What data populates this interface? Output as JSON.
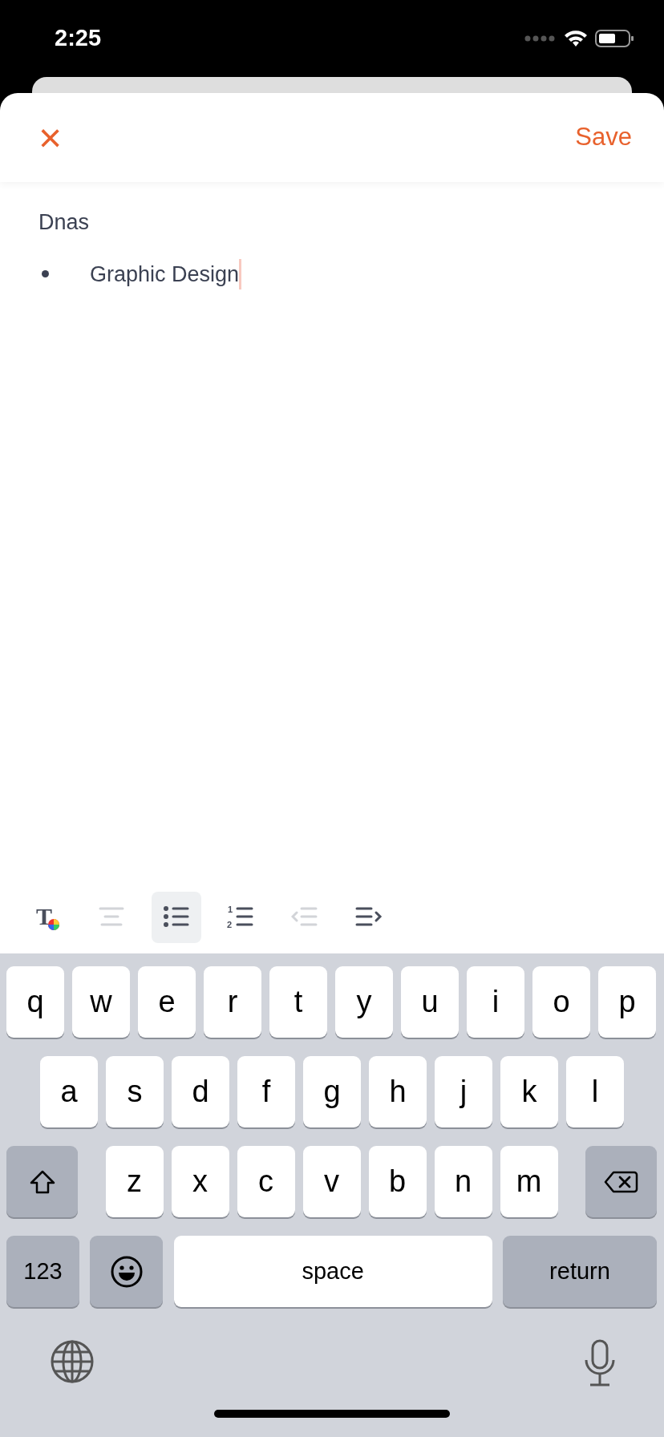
{
  "status_bar": {
    "time": "2:25"
  },
  "header": {
    "close_label": "×",
    "save_label": "Save"
  },
  "document": {
    "title": "Dnas",
    "bullets": [
      {
        "text": "Graphic Design",
        "focused": true
      }
    ]
  },
  "toolbar": [
    {
      "kind": "text-color",
      "glyph": "T",
      "selected": false,
      "disabled": false
    },
    {
      "kind": "align",
      "selected": false,
      "disabled": true
    },
    {
      "kind": "bullet-list",
      "selected": true,
      "disabled": false
    },
    {
      "kind": "numbered-list",
      "markers": [
        "1",
        "2"
      ],
      "selected": false,
      "disabled": false
    },
    {
      "kind": "outdent",
      "selected": false,
      "disabled": true
    },
    {
      "kind": "indent",
      "selected": false,
      "disabled": false
    }
  ],
  "keyboard": {
    "top_row": [
      {
        "kind": "letter",
        "label": "q"
      },
      {
        "kind": "letter",
        "label": "w"
      },
      {
        "kind": "letter",
        "label": "e"
      },
      {
        "kind": "letter",
        "label": "r"
      },
      {
        "kind": "letter",
        "label": "t"
      },
      {
        "kind": "letter",
        "label": "y"
      },
      {
        "kind": "letter",
        "label": "u"
      },
      {
        "kind": "letter",
        "label": "i"
      },
      {
        "kind": "letter",
        "label": "o"
      },
      {
        "kind": "letter",
        "label": "p"
      }
    ],
    "middle_row": [
      {
        "kind": "letter",
        "label": "a"
      },
      {
        "kind": "letter",
        "label": "s"
      },
      {
        "kind": "letter",
        "label": "d"
      },
      {
        "kind": "letter",
        "label": "f"
      },
      {
        "kind": "letter",
        "label": "g"
      },
      {
        "kind": "letter",
        "label": "h"
      },
      {
        "kind": "letter",
        "label": "j"
      },
      {
        "kind": "letter",
        "label": "k"
      },
      {
        "kind": "letter",
        "label": "l"
      }
    ],
    "lower_row": [
      {
        "kind": "shift"
      },
      {
        "kind": "letter",
        "label": "z"
      },
      {
        "kind": "letter",
        "label": "x"
      },
      {
        "kind": "letter",
        "label": "c"
      },
      {
        "kind": "letter",
        "label": "v"
      },
      {
        "kind": "letter",
        "label": "b"
      },
      {
        "kind": "letter",
        "label": "n"
      },
      {
        "kind": "letter",
        "label": "m"
      },
      {
        "kind": "delete"
      }
    ],
    "bottom_row": [
      {
        "kind": "numbers",
        "label": "123"
      },
      {
        "kind": "emoji"
      },
      {
        "kind": "space",
        "label": "space"
      },
      {
        "kind": "return",
        "label": "return"
      }
    ]
  }
}
